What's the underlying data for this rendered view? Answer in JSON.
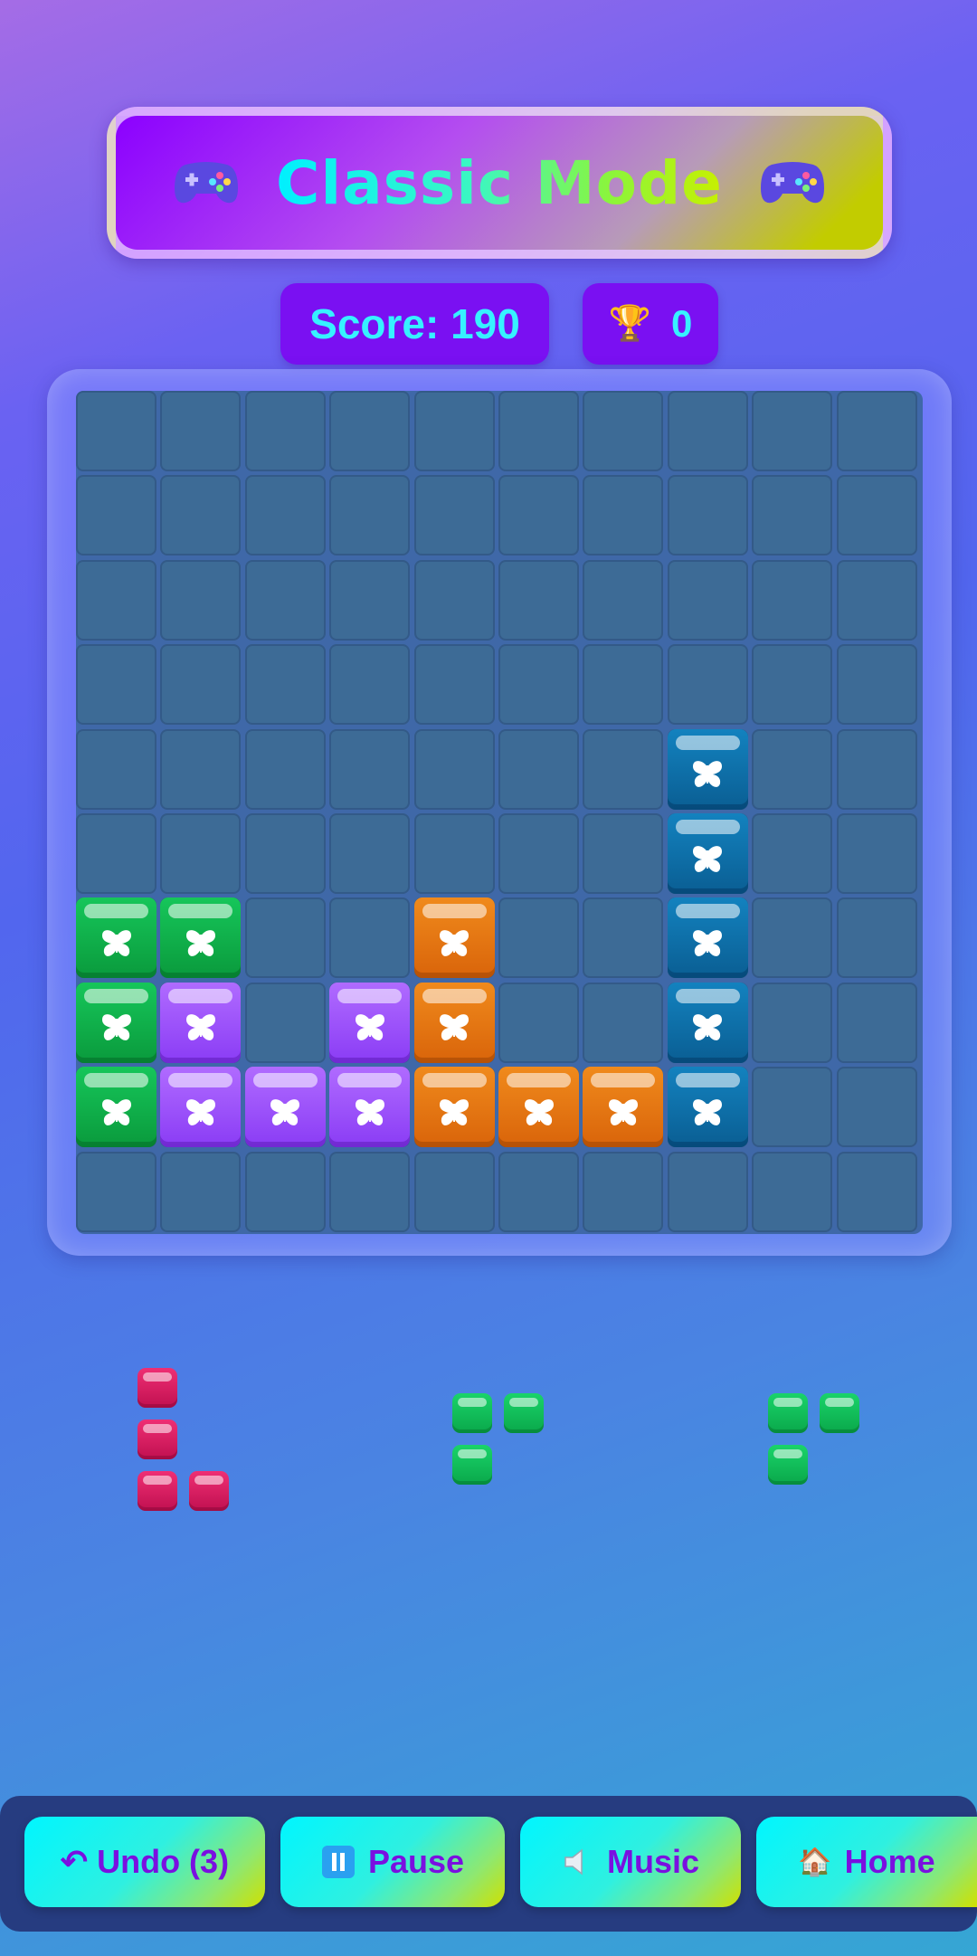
{
  "header": {
    "title": "Classic Mode",
    "left_icon": "gamepad-icon",
    "right_icon": "gamepad-icon"
  },
  "stats": {
    "score_label": "Score: 190",
    "best_icon": "trophy-icon",
    "best_value": "0"
  },
  "board": {
    "columns": 10,
    "rows": 10,
    "block_icon": "butterfly-icon",
    "filled": [
      {
        "row": 4,
        "col": 7,
        "color": "blue"
      },
      {
        "row": 5,
        "col": 7,
        "color": "blue"
      },
      {
        "row": 6,
        "col": 0,
        "color": "green"
      },
      {
        "row": 6,
        "col": 1,
        "color": "green"
      },
      {
        "row": 6,
        "col": 4,
        "color": "orange"
      },
      {
        "row": 6,
        "col": 7,
        "color": "blue"
      },
      {
        "row": 7,
        "col": 0,
        "color": "green"
      },
      {
        "row": 7,
        "col": 1,
        "color": "purple"
      },
      {
        "row": 7,
        "col": 3,
        "color": "purple"
      },
      {
        "row": 7,
        "col": 4,
        "color": "orange"
      },
      {
        "row": 7,
        "col": 7,
        "color": "blue"
      },
      {
        "row": 8,
        "col": 0,
        "color": "green"
      },
      {
        "row": 8,
        "col": 1,
        "color": "purple"
      },
      {
        "row": 8,
        "col": 2,
        "color": "purple"
      },
      {
        "row": 8,
        "col": 3,
        "color": "purple"
      },
      {
        "row": 8,
        "col": 4,
        "color": "orange"
      },
      {
        "row": 8,
        "col": 5,
        "color": "orange"
      },
      {
        "row": 8,
        "col": 6,
        "color": "orange"
      },
      {
        "row": 8,
        "col": 7,
        "color": "blue"
      }
    ]
  },
  "tray": {
    "pieces": [
      {
        "color": "pink",
        "cells": [
          [
            0,
            0
          ],
          [
            1,
            0
          ],
          [
            2,
            0
          ],
          [
            2,
            1
          ]
        ]
      },
      {
        "color": "green",
        "cells": [
          [
            0,
            0
          ],
          [
            0,
            1
          ],
          [
            1,
            0
          ]
        ]
      },
      {
        "color": "green",
        "cells": [
          [
            0,
            0
          ],
          [
            0,
            1
          ],
          [
            1,
            0
          ]
        ]
      }
    ]
  },
  "toolbar": {
    "undo_icon": "undo-arrow-icon",
    "undo_label": "↶ Undo (3)",
    "pause_icon": "pause-icon",
    "pause_label": "Pause",
    "music_icon": "speaker-icon",
    "music_label": "Music",
    "home_icon": "house-icon",
    "home_label": "Home"
  },
  "colors": {
    "green": "#16c65a",
    "purple": "#a05cff",
    "orange": "#ec7d14",
    "blue": "#0f74ad",
    "pink": "#e02266",
    "accent_text": "#36f2ff",
    "pill_bg": "#7a10f2"
  }
}
